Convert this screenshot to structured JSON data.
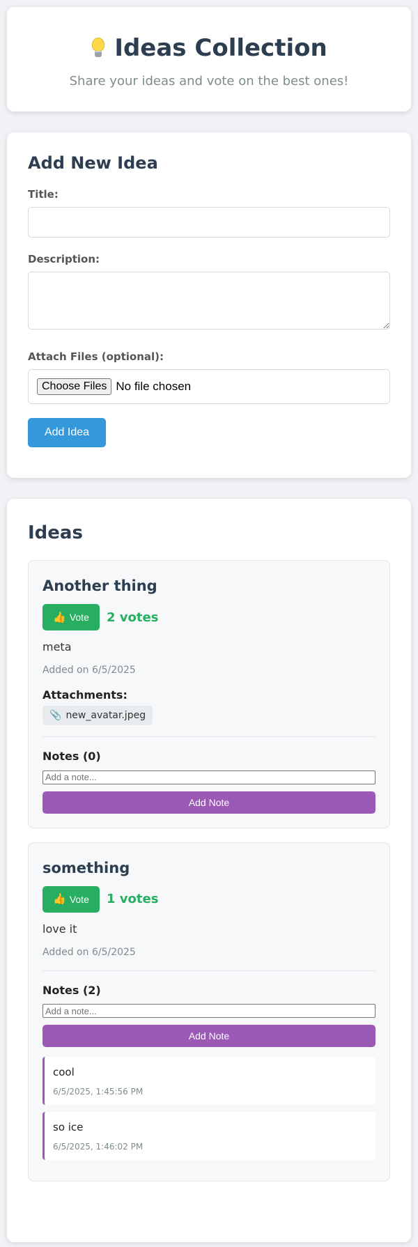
{
  "header": {
    "title": "Ideas Collection",
    "subtitle": "Share your ideas and vote on the best ones!",
    "icon": "lightbulb-icon"
  },
  "form": {
    "title": "Add New Idea",
    "title_label": "Title:",
    "title_value": "",
    "description_label": "Description:",
    "description_value": "",
    "files_label": "Attach Files (optional):",
    "choose_files_label": "Choose Files",
    "file_status": "No file chosen",
    "submit_label": "Add Idea"
  },
  "ideas_section": {
    "title": "Ideas",
    "vote_label": "Vote",
    "note_placeholder": "Add a note...",
    "add_note_label": "Add Note",
    "attachments_label": "Attachments:"
  },
  "ideas": [
    {
      "title": "Another thing",
      "votes": "2 votes",
      "description": "meta",
      "date": "Added on 6/5/2025",
      "attachments": [
        "new_avatar.jpeg"
      ],
      "notes_label": "Notes (0)",
      "notes": []
    },
    {
      "title": "something",
      "votes": "1 votes",
      "description": "love it",
      "date": "Added on 6/5/2025",
      "attachments": [],
      "notes_label": "Notes (2)",
      "notes": [
        {
          "text": "cool",
          "time": "6/5/2025, 1:45:56 PM"
        },
        {
          "text": "so ice",
          "time": "6/5/2025, 1:46:02 PM"
        }
      ]
    }
  ],
  "colors": {
    "primary": "#3498db",
    "vote": "#27ae60",
    "note": "#9b59b6",
    "heading": "#2c3e50"
  }
}
